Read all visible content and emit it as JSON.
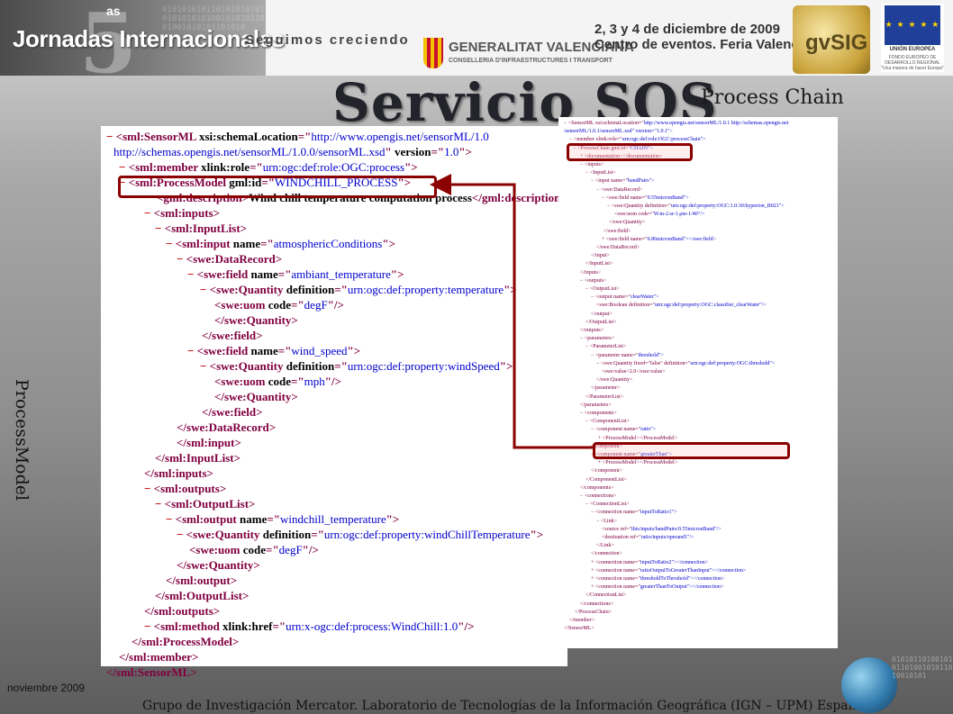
{
  "header": {
    "event_as": "as",
    "event_name": "Jornadas Internacionales",
    "slogan": "Seguimos creciendo",
    "binary": "0101010101101010101011010101010100101010110101001010101101010",
    "gva_title": "GENERALITAT VALENCIANA",
    "gva_sub": "CONSELLERIA D'INFRAESTRUCTURES I TRANSPORT",
    "dates_line1": "2, 3 y 4 de diciembre de 2009",
    "dates_line2": "Centro de eventos. Feria Valencia",
    "gvsig": "gvSIG",
    "eu_flag": "★ ★ ★ ★ ★",
    "eu_line1": "UNIÓN EUROPEA",
    "eu_line2": "FONDO EUROPEO DE DESARROLLO REGIONAL",
    "eu_line3": "\"Una manera de hacer Europa\""
  },
  "title": "Servicio SOS",
  "subtitle": "Process Chain",
  "side_label": "ProcessModel",
  "code": [
    {
      "p": [
        [
          "x",
          "− "
        ],
        [
          "t",
          "<sml:SensorML "
        ],
        [
          "a",
          "xsi:schemaLocation"
        ],
        [
          "t",
          "=\""
        ],
        [
          "v",
          "http://www.opengis.net/sensorML/1.0"
        ]
      ]
    },
    {
      "p": [
        [
          "v",
          "http://schemas.opengis.net/sensorML/1.0.0/sensorML.xsd"
        ],
        [
          "t",
          "\" "
        ],
        [
          "a",
          "version"
        ],
        [
          "t",
          "=\""
        ],
        [
          "v",
          "1.0"
        ],
        [
          "t",
          "\">"
        ]
      ]
    },
    {
      "p": [
        [
          "x",
          "− "
        ],
        [
          "t",
          "<sml:member "
        ],
        [
          "a",
          "xlink:role"
        ],
        [
          "t",
          "=\""
        ],
        [
          "v",
          "urn:ogc:def:role:OGC:process"
        ],
        [
          "t",
          "\">"
        ]
      ]
    },
    {
      "p": [
        [
          "x",
          "− "
        ],
        [
          "t",
          "<sml:ProcessModel "
        ],
        [
          "a",
          "gml:id"
        ],
        [
          "t",
          "=\""
        ],
        [
          "v",
          "WINDCHILL_PROCESS"
        ],
        [
          "t",
          "\">"
        ]
      ]
    },
    {
      "p": [
        [
          "t",
          "<gml:description>"
        ],
        [
          "a",
          "Wind chill temperature computation process"
        ],
        [
          "t",
          "</gml:description>"
        ]
      ]
    },
    {
      "p": [
        [
          "x",
          "− "
        ],
        [
          "t",
          "<sml:inputs>"
        ]
      ]
    },
    {
      "p": [
        [
          "x",
          "− "
        ],
        [
          "t",
          "<sml:InputList>"
        ]
      ]
    },
    {
      "p": [
        [
          "x",
          "− "
        ],
        [
          "t",
          "<sml:input "
        ],
        [
          "a",
          "name"
        ],
        [
          "t",
          "=\""
        ],
        [
          "v",
          "atmosphericConditions"
        ],
        [
          "t",
          "\">"
        ]
      ]
    },
    {
      "p": [
        [
          "x",
          "− "
        ],
        [
          "t",
          "<swe:DataRecord>"
        ]
      ]
    },
    {
      "p": [
        [
          "x",
          "− "
        ],
        [
          "t",
          "<swe:field "
        ],
        [
          "a",
          "name"
        ],
        [
          "t",
          "=\""
        ],
        [
          "v",
          "ambiant_temperature"
        ],
        [
          "t",
          "\">"
        ]
      ]
    },
    {
      "p": [
        [
          "x",
          "− "
        ],
        [
          "t",
          "<swe:Quantity "
        ],
        [
          "a",
          "definition"
        ],
        [
          "t",
          "=\""
        ],
        [
          "v",
          "urn:ogc:def:property:temperature"
        ],
        [
          "t",
          "\">"
        ]
      ]
    },
    {
      "p": [
        [
          "t",
          "<swe:uom "
        ],
        [
          "a",
          "code"
        ],
        [
          "t",
          "=\""
        ],
        [
          "v",
          "degF"
        ],
        [
          "t",
          "\"/>"
        ]
      ]
    },
    {
      "p": [
        [
          "t",
          "</swe:Quantity>"
        ]
      ]
    },
    {
      "p": [
        [
          "t",
          "</swe:field>"
        ]
      ]
    },
    {
      "p": [
        [
          "x",
          "− "
        ],
        [
          "t",
          "<swe:field "
        ],
        [
          "a",
          "name"
        ],
        [
          "t",
          "=\""
        ],
        [
          "v",
          "wind_speed"
        ],
        [
          "t",
          "\">"
        ]
      ]
    },
    {
      "p": [
        [
          "x",
          "− "
        ],
        [
          "t",
          "<swe:Quantity "
        ],
        [
          "a",
          "definition"
        ],
        [
          "t",
          "=\""
        ],
        [
          "v",
          "urn:ogc:def:property:windSpeed"
        ],
        [
          "t",
          "\">"
        ]
      ]
    },
    {
      "p": [
        [
          "t",
          "<swe:uom "
        ],
        [
          "a",
          "code"
        ],
        [
          "t",
          "=\""
        ],
        [
          "v",
          "mph"
        ],
        [
          "t",
          "\"/>"
        ]
      ]
    },
    {
      "p": [
        [
          "t",
          "</swe:Quantity>"
        ]
      ]
    },
    {
      "p": [
        [
          "t",
          "</swe:field>"
        ]
      ]
    },
    {
      "p": [
        [
          "t",
          "</swe:DataRecord>"
        ]
      ]
    },
    {
      "p": [
        [
          "t",
          "</sml:input>"
        ]
      ]
    },
    {
      "p": [
        [
          "t",
          "</sml:InputList>"
        ]
      ]
    },
    {
      "p": [
        [
          "t",
          "</sml:inputs>"
        ]
      ]
    },
    {
      "p": [
        [
          "x",
          "− "
        ],
        [
          "t",
          "<sml:outputs>"
        ]
      ]
    },
    {
      "p": [
        [
          "x",
          "− "
        ],
        [
          "t",
          "<sml:OutputList>"
        ]
      ]
    },
    {
      "p": [
        [
          "x",
          "− "
        ],
        [
          "t",
          "<sml:output "
        ],
        [
          "a",
          "name"
        ],
        [
          "t",
          "=\""
        ],
        [
          "v",
          "windchill_temperature"
        ],
        [
          "t",
          "\">"
        ]
      ]
    },
    {
      "p": [
        [
          "x",
          "− "
        ],
        [
          "t",
          "<swe:Quantity "
        ],
        [
          "a",
          "definition"
        ],
        [
          "t",
          "=\""
        ],
        [
          "v",
          "urn:ogc:def:property:windChillTemperature"
        ],
        [
          "t",
          "\">"
        ]
      ]
    },
    {
      "p": [
        [
          "t",
          "<swe:uom "
        ],
        [
          "a",
          "code"
        ],
        [
          "t",
          "=\""
        ],
        [
          "v",
          "degF"
        ],
        [
          "t",
          "\"/>"
        ]
      ]
    },
    {
      "p": [
        [
          "t",
          "</swe:Quantity>"
        ]
      ]
    },
    {
      "p": [
        [
          "t",
          "</sml:output>"
        ]
      ]
    },
    {
      "p": [
        [
          "t",
          "</sml:OutputList>"
        ]
      ]
    },
    {
      "p": [
        [
          "t",
          "</sml:outputs>"
        ]
      ]
    },
    {
      "p": [
        [
          "x",
          "− "
        ],
        [
          "t",
          "<sml:method "
        ],
        [
          "a",
          "xlink:href"
        ],
        [
          "t",
          "=\""
        ],
        [
          "v",
          "urn:x-ogc:def:process:WindChill:1.0"
        ],
        [
          "t",
          "\"/>"
        ]
      ]
    },
    {
      "p": [
        [
          "t",
          "</sml:ProcessModel>"
        ]
      ]
    },
    {
      "p": [
        [
          "t",
          "</sml:member>"
        ]
      ]
    },
    {
      "p": [
        [
          "t",
          "</sml:SensorML>"
        ]
      ]
    }
  ],
  "thumb": [
    {
      "t": "− <SensorML xsi:schemaLocation=\"",
      "v": "http://www.opengis.net/sensorML/1.0.1 http://schemas.opengis.net"
    },
    {
      "t": "",
      "v": "/sensorML/1.0.1/sensorML.xsd\" version=\"1.0.1\">"
    },
    {
      "t": "− <member xlink:role=\"",
      "v": "urn:ogc:def:role:OGC:processChain\">"
    },
    {
      "t": "− <ProcessChain gml:id=\"",
      "v": "CHAIN\">"
    },
    {
      "t": "+ <documentation></documentation>",
      "v": ""
    },
    {
      "t": "− <inputs>",
      "v": ""
    },
    {
      "t": "− <InputList>",
      "v": ""
    },
    {
      "t": "− <input name=\"",
      "v": "bandPairs\">"
    },
    {
      "t": "− <swe:DataRecord>",
      "v": ""
    },
    {
      "t": "− <swe:field name=\"",
      "v": "0.55micronBand\">"
    },
    {
      "t": "− <swe:Quantity definition=\"",
      "v": "urn:ogc:def:property:OGC:1.0:30:hyperion_B021\">"
    },
    {
      "t": "<swe:uom code=\"",
      "v": "W.m-2.sr-1.μm-1/40\"/>"
    },
    {
      "t": "</swe:Quantity>",
      "v": ""
    },
    {
      "t": "</swe:field>",
      "v": ""
    },
    {
      "t": "+ <swe:field name=\"",
      "v": "0.86micronBand\"></swe:field>"
    },
    {
      "t": "</swe:DataRecord>",
      "v": ""
    },
    {
      "t": "</input>",
      "v": ""
    },
    {
      "t": "</InputList>",
      "v": ""
    },
    {
      "t": "</inputs>",
      "v": ""
    },
    {
      "t": "− <outputs>",
      "v": ""
    },
    {
      "t": "− <OutputList>",
      "v": ""
    },
    {
      "t": "− <output name=\"",
      "v": "clearWater\">"
    },
    {
      "t": "<swe:Boolean definition=\"",
      "v": "urn:ogc:def:property:OGC:classifier_clearWater\"/>"
    },
    {
      "t": "</output>",
      "v": ""
    },
    {
      "t": "</OutputList>",
      "v": ""
    },
    {
      "t": "</outputs>",
      "v": ""
    },
    {
      "t": "− <parameters>",
      "v": ""
    },
    {
      "t": "− <ParameterList>",
      "v": ""
    },
    {
      "t": "− <parameter name=\"",
      "v": "threshold\">"
    },
    {
      "t": "− <swe:Quantity fixed=\"false\" definition=\"",
      "v": "urn:ogc:def:property:OGC:threshold\">"
    },
    {
      "t": "<swe:value>2.0</swe:value>",
      "v": ""
    },
    {
      "t": "</swe:Quantity>",
      "v": ""
    },
    {
      "t": "</parameter>",
      "v": ""
    },
    {
      "t": "</ParameterList>",
      "v": ""
    },
    {
      "t": "</parameters>",
      "v": ""
    },
    {
      "t": "− <components>",
      "v": ""
    },
    {
      "t": "− <ComponentList>",
      "v": ""
    },
    {
      "t": "− <component name=\"",
      "v": "ratio\">"
    },
    {
      "t": "+ <ProcessModel></ProcessModel>",
      "v": ""
    },
    {
      "t": "</component>",
      "v": ""
    },
    {
      "t": "− <component name=\"",
      "v": "greaterThan\">"
    },
    {
      "t": "+ <ProcessModel></ProcessModel>",
      "v": ""
    },
    {
      "t": "</component>",
      "v": ""
    },
    {
      "t": "</ComponentList>",
      "v": ""
    },
    {
      "t": "</components>",
      "v": ""
    },
    {
      "t": "− <connections>",
      "v": ""
    },
    {
      "t": "− <ConnectionList>",
      "v": ""
    },
    {
      "t": "− <connection name=\"",
      "v": "inputToRatio1\">"
    },
    {
      "t": "− <Link>",
      "v": ""
    },
    {
      "t": "<source ref=\"",
      "v": "this/inputs/bandPairs/0.55micronBand\"/>"
    },
    {
      "t": "<destination ref=\"",
      "v": "ratio/inputs/operand1\"/>"
    },
    {
      "t": "</Link>",
      "v": ""
    },
    {
      "t": "</connection>",
      "v": ""
    },
    {
      "t": "+ <connection name=\"",
      "v": "inputToRatio2\"></connection>"
    },
    {
      "t": "+ <connection name=\"",
      "v": "ratioOutputToGreaterThanInput\"></connection>"
    },
    {
      "t": "+ <connection name=\"",
      "v": "thresholdToThreshold\"></connection>"
    },
    {
      "t": "+ <connection name=\"",
      "v": "greaterThanToOutput\"></connection>"
    },
    {
      "t": "</ConnectionList>",
      "v": ""
    },
    {
      "t": "</connections>",
      "v": ""
    },
    {
      "t": "</ProcessChain>",
      "v": ""
    },
    {
      "t": "</member>",
      "v": ""
    },
    {
      "t": "</SensorML>",
      "v": ""
    }
  ],
  "footer": {
    "date": "noviembre 2009",
    "credit": "Grupo de Investigación Mercator. Laboratorio de Tecnologías de la Información Geográfica (IGN – UPM) España",
    "binary": "010101101001010110100101011010010101"
  },
  "colors": {
    "highlight": "#8b0000",
    "xml_tag": "#800040",
    "xml_value": "#0000cc",
    "toggle": "#c00000"
  }
}
